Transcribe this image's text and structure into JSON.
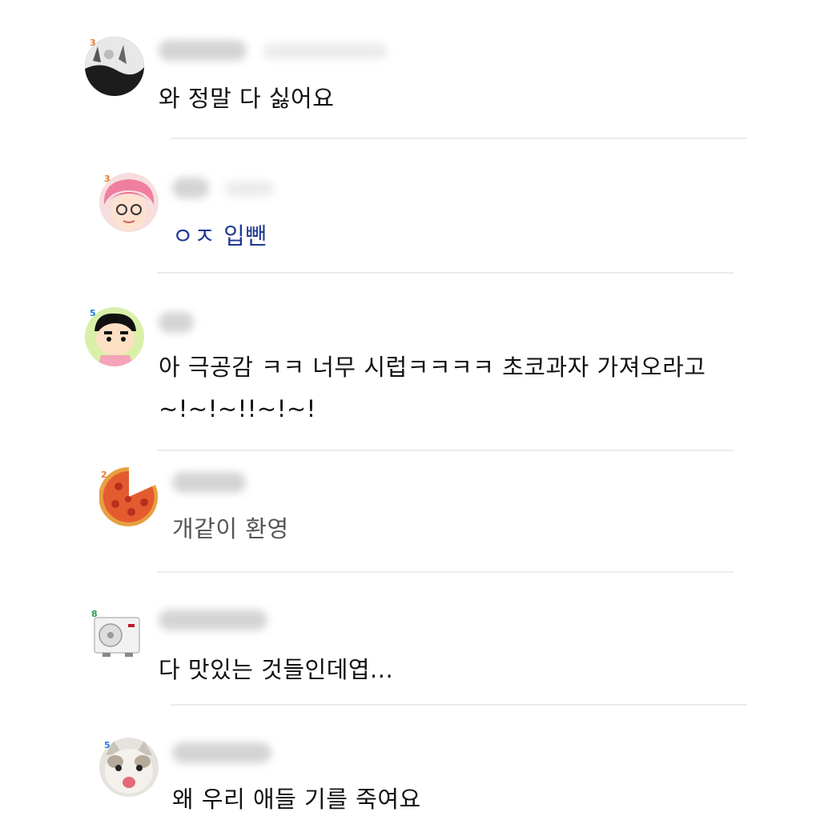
{
  "comments": [
    {
      "level": "3",
      "level_color": "#e07b39",
      "text": "와 정말 다 싫어요",
      "text_color": "#111111",
      "avatar": "moon-photo-avatar"
    },
    {
      "level": "3",
      "level_color": "#e07b39",
      "text": "ㅇㅈ 입뺀",
      "text_color": "#1f3a93",
      "avatar": "pink-hair-anime-avatar"
    },
    {
      "level": "5",
      "level_color": "#2a7de1",
      "text_line1": "아 극공감 ㅋㅋ 너무 시럽ㅋㅋㅋㅋ 초코과자 가져오라고",
      "text_line2": "~!~!~!!~!~!",
      "text_color": "#111111",
      "avatar": "cartoon-boy-avatar"
    },
    {
      "level": "2",
      "level_color": "#e07b39",
      "text": "개같이 환영",
      "text_color": "#555555",
      "avatar": "pizza-avatar"
    },
    {
      "level": "8",
      "level_color": "#2e9e4f",
      "text": "다 맛있는 것들인데엽...",
      "text_color": "#111111",
      "avatar": "air-conditioner-avatar"
    },
    {
      "level": "5",
      "level_color": "#2a7de1",
      "text": "왜 우리 애들 기를 죽여요",
      "text_color": "#111111",
      "avatar": "cat-avatar"
    }
  ]
}
